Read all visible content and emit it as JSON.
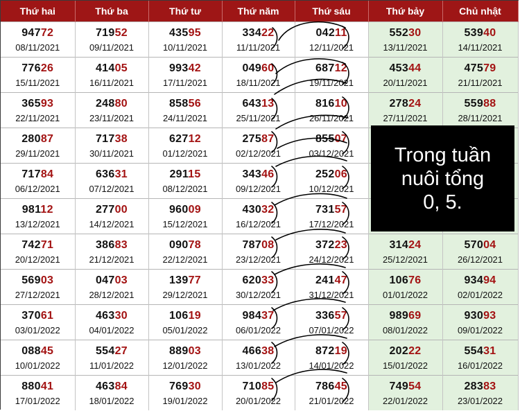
{
  "headers": [
    "Thứ hai",
    "Thứ ba",
    "Thứ tư",
    "Thứ năm",
    "Thứ sáu",
    "Thứ bảy",
    "Chủ nhật"
  ],
  "rows": [
    [
      {
        "head": "947",
        "tail": "72",
        "date": "08/11/2021"
      },
      {
        "head": "719",
        "tail": "52",
        "date": "09/11/2021"
      },
      {
        "head": "435",
        "tail": "95",
        "date": "10/11/2021"
      },
      {
        "head": "334",
        "tail": "22",
        "date": "11/11/2021"
      },
      {
        "head": "042",
        "tail": "11",
        "date": "12/11/2021"
      },
      {
        "head": "552",
        "tail": "30",
        "date": "13/11/2021"
      },
      {
        "head": "539",
        "tail": "40",
        "date": "14/11/2021"
      }
    ],
    [
      {
        "head": "776",
        "tail": "26",
        "date": "15/11/2021"
      },
      {
        "head": "414",
        "tail": "05",
        "date": "16/11/2021"
      },
      {
        "head": "993",
        "tail": "42",
        "date": "17/11/2021"
      },
      {
        "head": "049",
        "tail": "60",
        "date": "18/11/2021"
      },
      {
        "head": "687",
        "tail": "12",
        "date": "19/11/2021"
      },
      {
        "head": "453",
        "tail": "44",
        "date": "20/11/2021"
      },
      {
        "head": "475",
        "tail": "79",
        "date": "21/11/2021"
      }
    ],
    [
      {
        "head": "365",
        "tail": "93",
        "date": "22/11/2021"
      },
      {
        "head": "248",
        "tail": "80",
        "date": "23/11/2021"
      },
      {
        "head": "858",
        "tail": "56",
        "date": "24/11/2021"
      },
      {
        "head": "643",
        "tail": "13",
        "date": "25/11/2021"
      },
      {
        "head": "816",
        "tail": "10",
        "date": "26/11/2021"
      },
      {
        "head": "278",
        "tail": "24",
        "date": "27/11/2021"
      },
      {
        "head": "559",
        "tail": "88",
        "date": "28/11/2021"
      }
    ],
    [
      {
        "head": "280",
        "tail": "87",
        "date": "29/11/2021"
      },
      {
        "head": "717",
        "tail": "38",
        "date": "30/11/2021"
      },
      {
        "head": "627",
        "tail": "12",
        "date": "01/12/2021"
      },
      {
        "head": "275",
        "tail": "87",
        "date": "02/12/2021"
      },
      {
        "head": "855",
        "tail": "07",
        "date": "03/12/2021"
      },
      {
        "head": "",
        "tail": "",
        "date": ""
      },
      {
        "head": "",
        "tail": "",
        "date": ""
      }
    ],
    [
      {
        "head": "717",
        "tail": "84",
        "date": "06/12/2021"
      },
      {
        "head": "636",
        "tail": "31",
        "date": "07/12/2021"
      },
      {
        "head": "291",
        "tail": "15",
        "date": "08/12/2021"
      },
      {
        "head": "343",
        "tail": "46",
        "date": "09/12/2021"
      },
      {
        "head": "252",
        "tail": "06",
        "date": "10/12/2021"
      },
      {
        "head": "",
        "tail": "",
        "date": ""
      },
      {
        "head": "",
        "tail": "",
        "date": ""
      }
    ],
    [
      {
        "head": "981",
        "tail": "12",
        "date": "13/12/2021"
      },
      {
        "head": "277",
        "tail": "00",
        "date": "14/12/2021"
      },
      {
        "head": "960",
        "tail": "09",
        "date": "15/12/2021"
      },
      {
        "head": "430",
        "tail": "32",
        "date": "16/12/2021"
      },
      {
        "head": "731",
        "tail": "57",
        "date": "17/12/2021"
      },
      {
        "head": "",
        "tail": "",
        "date": ""
      },
      {
        "head": "",
        "tail": "",
        "date": ""
      }
    ],
    [
      {
        "head": "742",
        "tail": "71",
        "date": "20/12/2021"
      },
      {
        "head": "386",
        "tail": "83",
        "date": "21/12/2021"
      },
      {
        "head": "090",
        "tail": "78",
        "date": "22/12/2021"
      },
      {
        "head": "787",
        "tail": "08",
        "date": "23/12/2021"
      },
      {
        "head": "372",
        "tail": "23",
        "date": "24/12/2021"
      },
      {
        "head": "314",
        "tail": "24",
        "date": "25/12/2021"
      },
      {
        "head": "570",
        "tail": "04",
        "date": "26/12/2021"
      }
    ],
    [
      {
        "head": "569",
        "tail": "03",
        "date": "27/12/2021"
      },
      {
        "head": "047",
        "tail": "03",
        "date": "28/12/2021"
      },
      {
        "head": "139",
        "tail": "77",
        "date": "29/12/2021"
      },
      {
        "head": "620",
        "tail": "33",
        "date": "30/12/2021"
      },
      {
        "head": "241",
        "tail": "47",
        "date": "31/12/2021"
      },
      {
        "head": "106",
        "tail": "76",
        "date": "01/01/2022"
      },
      {
        "head": "934",
        "tail": "94",
        "date": "02/01/2022"
      }
    ],
    [
      {
        "head": "370",
        "tail": "61",
        "date": "03/01/2022"
      },
      {
        "head": "463",
        "tail": "30",
        "date": "04/01/2022"
      },
      {
        "head": "106",
        "tail": "19",
        "date": "05/01/2022"
      },
      {
        "head": "984",
        "tail": "37",
        "date": "06/01/2022"
      },
      {
        "head": "336",
        "tail": "57",
        "date": "07/01/2022"
      },
      {
        "head": "989",
        "tail": "69",
        "date": "08/01/2022"
      },
      {
        "head": "930",
        "tail": "93",
        "date": "09/01/2022"
      }
    ],
    [
      {
        "head": "088",
        "tail": "45",
        "date": "10/01/2022"
      },
      {
        "head": "554",
        "tail": "27",
        "date": "11/01/2022"
      },
      {
        "head": "889",
        "tail": "03",
        "date": "12/01/2022"
      },
      {
        "head": "466",
        "tail": "38",
        "date": "13/01/2022"
      },
      {
        "head": "872",
        "tail": "19",
        "date": "14/01/2022"
      },
      {
        "head": "202",
        "tail": "22",
        "date": "15/01/2022"
      },
      {
        "head": "554",
        "tail": "31",
        "date": "16/01/2022"
      }
    ],
    [
      {
        "head": "880",
        "tail": "41",
        "date": "17/01/2022"
      },
      {
        "head": "463",
        "tail": "84",
        "date": "18/01/2022"
      },
      {
        "head": "769",
        "tail": "30",
        "date": "19/01/2022"
      },
      {
        "head": "710",
        "tail": "85",
        "date": "20/01/2022"
      },
      {
        "head": "786",
        "tail": "45",
        "date": "21/01/2022"
      },
      {
        "head": "749",
        "tail": "54",
        "date": "22/01/2022"
      },
      {
        "head": "283",
        "tail": "83",
        "date": "23/01/2022"
      }
    ]
  ],
  "note": {
    "line1": "Trong tuần",
    "line2": "nuôi tổng",
    "line3": "0, 5."
  }
}
